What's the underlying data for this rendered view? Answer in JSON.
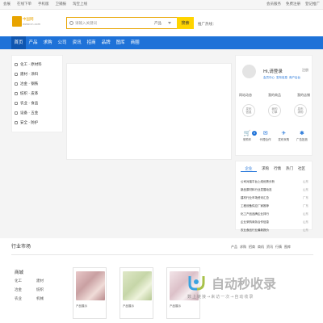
{
  "topbar": {
    "left": [
      "会展",
      "在线下单",
      "手机版",
      "卫捕报",
      "淘宝上线"
    ],
    "right": [
      "会员服务",
      "免费注册",
      "登记推广"
    ]
  },
  "logo": {
    "text": "中国网",
    "sub": "www.cn.com"
  },
  "search": {
    "placeholder": "请输入关键词",
    "category": "产品",
    "button": "搜索",
    "hotline": "推广热线："
  },
  "nav": [
    "首页",
    "产品",
    "求购",
    "公司",
    "资讯",
    "招商",
    "品牌",
    "图库",
    "商圈"
  ],
  "sidebar": [
    "化工 · 原材料",
    "建材 · 涂料",
    "冶金 · 钢铁",
    "纺织 · 皮革",
    "农业 · 食品",
    "设备 · 五金",
    "安全 · 防护"
  ],
  "user": {
    "greeting": "Hi,请登录",
    "register": "注册",
    "links": [
      "会员中心",
      "发布信息",
      "商户后台"
    ],
    "tabs": [
      "网站动态",
      "我的商品",
      "我的店铺"
    ],
    "circles": [
      "发布<br>信息",
      "我的<br>订单",
      "发布<br>求购"
    ],
    "actions": [
      {
        "icon": "🛒",
        "label": "采购车"
      },
      {
        "icon": "✉",
        "label": "代理合作"
      },
      {
        "icon": "✈",
        "label": "发布采购"
      },
      {
        "icon": "✱",
        "label": "广告投放"
      }
    ],
    "badge": "0"
  },
  "news": {
    "tabs": [
      "企业",
      "求购",
      "行情",
      "热门",
      "社区"
    ],
    "items": [
      {
        "title": "公司对接平台上线优势分析",
        "region": "山东"
      },
      {
        "title": "新品原材料行业发展动态",
        "region": "山东"
      },
      {
        "title": "建材行业市场资讯汇总",
        "region": "广东"
      },
      {
        "title": "工程设备供应厂家推荐",
        "region": "广东"
      },
      {
        "title": "化工产品品牌企业排行",
        "region": "山东"
      },
      {
        "title": "企业采购商务合作信息",
        "region": "山东"
      },
      {
        "title": "农业食品行业最新报价",
        "region": "山东"
      }
    ]
  },
  "market": {
    "title": "行业市场",
    "links": [
      "产品",
      "求购",
      "招商",
      "商机",
      "资讯",
      "行情",
      "图库"
    ],
    "region_title": "商城",
    "regions": [
      "化工",
      "建材",
      "冶金",
      "纺织",
      "农业",
      "机械"
    ],
    "cards": [
      "产品展示",
      "产品展示",
      "产品展示"
    ]
  },
  "watermark": {
    "title": "自动秒收录",
    "sub": "数上链接→来访一次→自动收录"
  },
  "colors": {
    "brand_blue": "#1e72d8",
    "search_yellow": "#ffd400",
    "logo_gold": "#e8a400"
  }
}
